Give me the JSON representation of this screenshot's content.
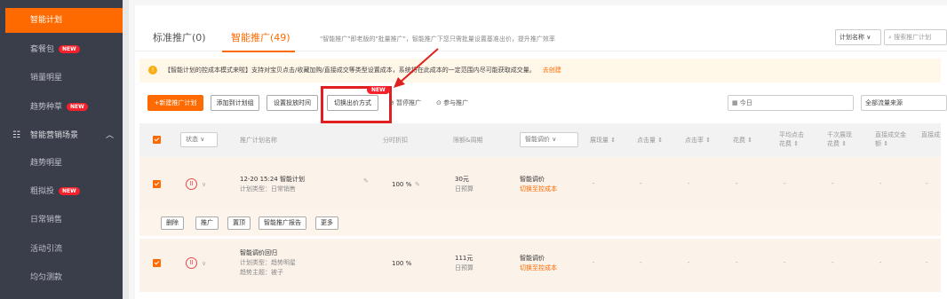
{
  "sidebar": {
    "items": [
      {
        "label": "智能计划",
        "active": true
      },
      {
        "label": "套餐包",
        "badge": "NEW"
      },
      {
        "label": "销量明星"
      },
      {
        "label": "趋势种草",
        "badge": "NEW"
      },
      {
        "label": "智能营销场景",
        "group": true
      },
      {
        "label": "趋势明星"
      },
      {
        "label": "粗拟投",
        "badge": "NEW"
      },
      {
        "label": "日常销售"
      },
      {
        "label": "活动引流"
      },
      {
        "label": "均匀测款"
      }
    ]
  },
  "tabs": {
    "standard": "标准推广(0)",
    "smart": "智能推广(49)",
    "desc": "\"智能推广\"即老版的\"批量推广\"，智能推广下您只需批量设置基准出价，提升推广效率"
  },
  "search": {
    "type": "计划名称",
    "placeholder": "搜索推广计划"
  },
  "notice": {
    "text": "【智能计划的控成本模式来啦】支持对宝贝点击/收藏加购/直接成交等类型设置成本，系统将在此成本的一定范围内尽可能获取成交量。",
    "link": "去创建"
  },
  "toolbar": {
    "new_plan": "+新建推广计划",
    "add_group": "添加到计划组",
    "set_time": "设置投放时间",
    "switch_bid": "切换出价方式",
    "new_tag": "NEW",
    "pause": "暂停推广",
    "join": "参与推广",
    "date": "今日",
    "traffic": "全部流量来源"
  },
  "table": {
    "status": "状态",
    "name": "推广计划名称",
    "discount": "分时折扣",
    "budget": "限额&周期",
    "bid": "智能调价",
    "cols": [
      "展现量",
      "点击量",
      "点击率",
      "花费",
      "平均点击花费",
      "千次展现花费",
      "直接成交金额",
      "直接成交笔数"
    ]
  },
  "rows": [
    {
      "name": "12-20 15:24 智能计划",
      "type": "计划类型：日常销售",
      "discount": "100 %",
      "budget": "30元",
      "budget_sub": "日预算",
      "bid": "智能调价",
      "bid_link": "切换至控成本"
    },
    {
      "name": "智能调价回归",
      "type": "计划类型：趋势明星",
      "theme": "趋势主题：被子",
      "discount": "100 %",
      "budget": "111元",
      "budget_sub": "日预算",
      "bid": "智能调价",
      "bid_link": "切换至控成本"
    }
  ],
  "row_actions": [
    "删除",
    "推广",
    "置顶",
    "智能推广报告",
    "更多"
  ],
  "dash": "-"
}
